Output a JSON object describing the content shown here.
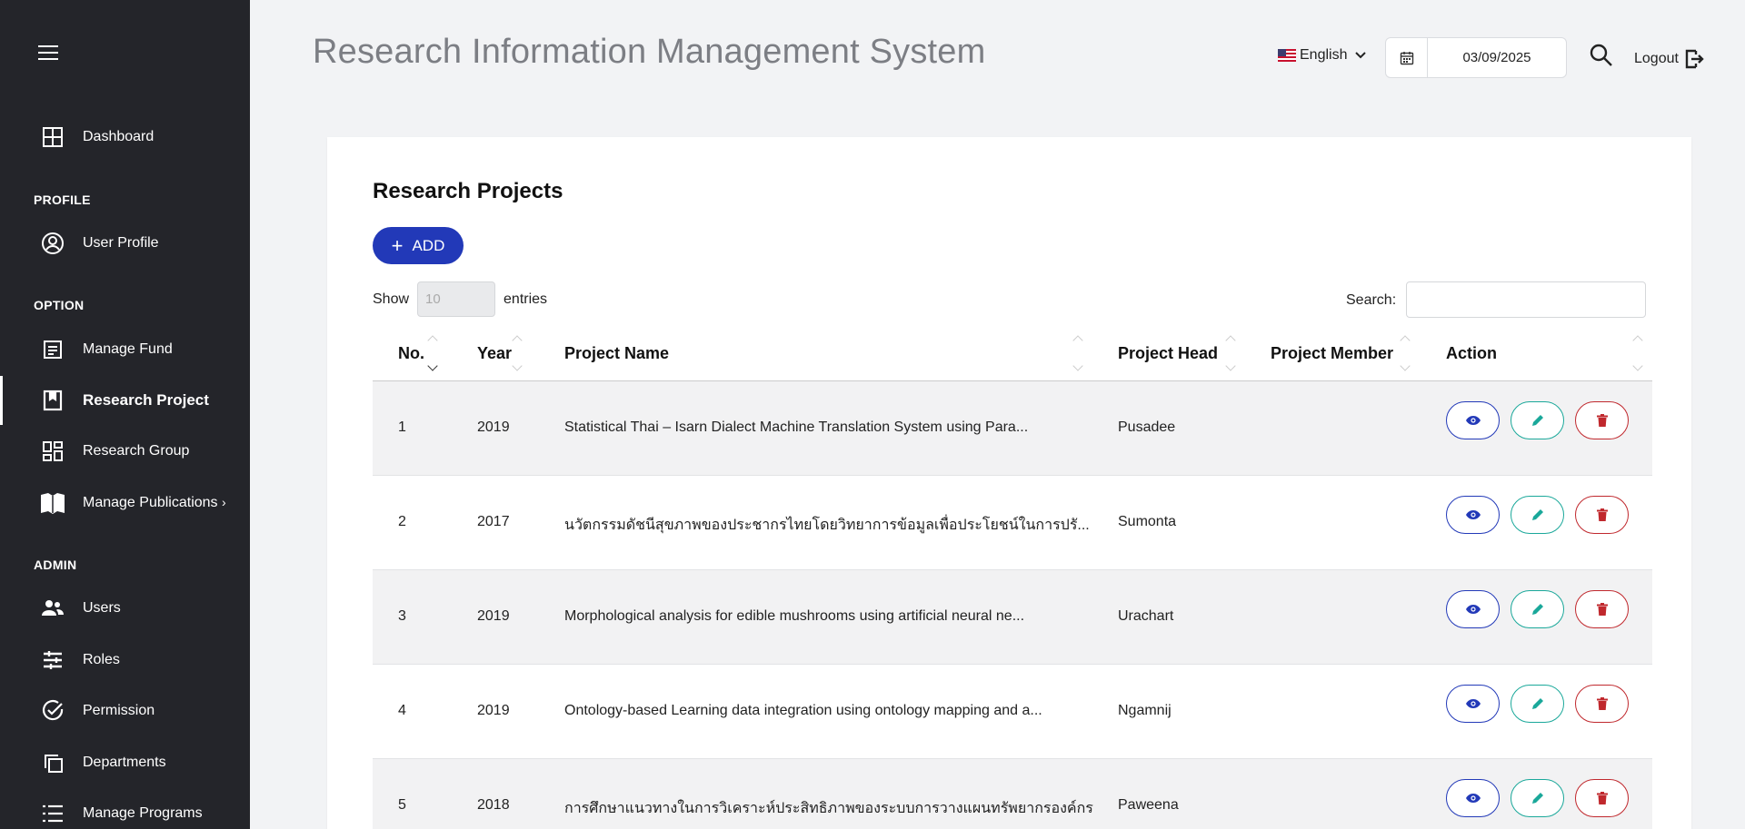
{
  "header": {
    "title": "Research Information Management System",
    "language": "English",
    "date": "03/09/2025",
    "logout_label": "Logout"
  },
  "sidebar": {
    "dashboard": "Dashboard",
    "section_profile": "PROFILE",
    "user_profile": "User Profile",
    "section_option": "OPTION",
    "manage_fund": "Manage Fund",
    "research_project": "Research Project",
    "research_group": "Research Group",
    "manage_publications": "Manage Publications",
    "section_admin": "ADMIN",
    "users": "Users",
    "roles": "Roles",
    "permission": "Permission",
    "departments": "Departments",
    "manage_programs": "Manage Programs"
  },
  "main": {
    "card_title": "Research Projects",
    "add_label": "ADD",
    "show_label": "Show",
    "entries_value": "10",
    "entries_label": "entries",
    "search_label": "Search:",
    "columns": [
      "No.",
      "Year",
      "Project Name",
      "Project Head",
      "Project Member",
      "Action"
    ],
    "rows": [
      {
        "no": "1",
        "year": "2019",
        "name": "Statistical Thai – Isarn Dialect Machine Translation System using Para...",
        "head": "Pusadee",
        "member": ""
      },
      {
        "no": "2",
        "year": "2017",
        "name": "นวัตกรรมดัชนีสุขภาพของประชากรไทยโดยวิทยาการข้อมูลเพื่อประโยชน์ในการปรั...",
        "head": "Sumonta",
        "member": ""
      },
      {
        "no": "3",
        "year": "2019",
        "name": "Morphological analysis for edible mushrooms using artificial neural ne...",
        "head": "Urachart",
        "member": ""
      },
      {
        "no": "4",
        "year": "2019",
        "name": "Ontology-based Learning data integration using ontology mapping and a...",
        "head": "Ngamnij",
        "member": ""
      },
      {
        "no": "5",
        "year": "2018",
        "name": "การศึกษาแนวทางในการวิเคราะห์ประสิทธิภาพของระบบการวางแผนทรัพยากรองค์กร",
        "head": "Paweena",
        "member": ""
      }
    ]
  },
  "colors": {
    "sidebar_bg": "#24252a",
    "primary": "#2239b8",
    "edit": "#1aa89a",
    "delete": "#c0282d"
  },
  "icons": [
    "menu-icon",
    "dashboard-icon",
    "user-circle-icon",
    "document-icon",
    "bookmark-icon",
    "grid-icon",
    "book-open-icon",
    "users-icon",
    "sliders-icon",
    "check-circle-icon",
    "copy-icon",
    "list-icon",
    "calendar-icon",
    "search-icon",
    "logout-icon",
    "eye-icon",
    "pencil-icon",
    "trash-icon"
  ]
}
